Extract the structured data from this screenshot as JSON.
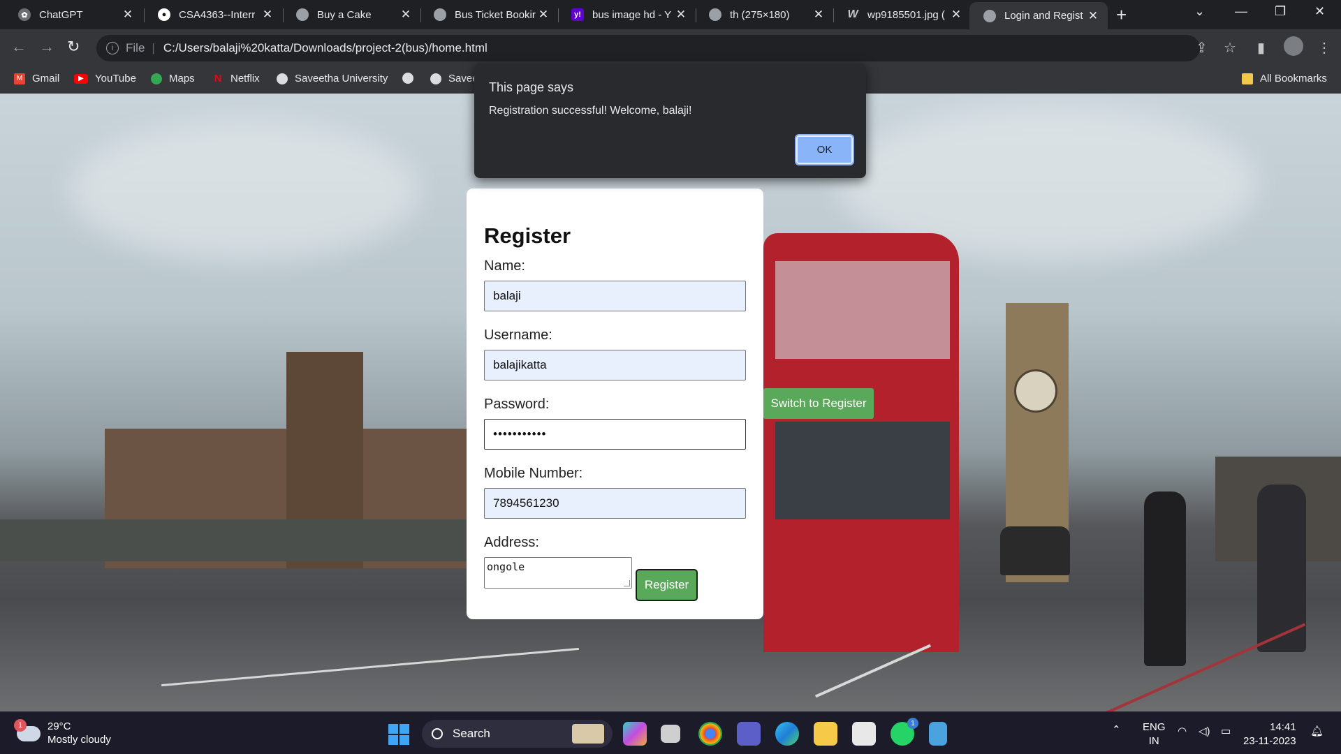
{
  "tabs": [
    {
      "title": "ChatGPT",
      "favicon": "chatgpt-icon"
    },
    {
      "title": "CSA4363--Interr",
      "favicon": "github-icon"
    },
    {
      "title": "Buy a Cake",
      "favicon": "globe-icon"
    },
    {
      "title": "Bus Ticket Bookir",
      "favicon": "globe-icon"
    },
    {
      "title": "bus image hd - Y",
      "favicon": "yahoo-icon"
    },
    {
      "title": "th (275×180)",
      "favicon": "globe-icon"
    },
    {
      "title": "wp9185501.jpg (",
      "favicon": "w-icon"
    },
    {
      "title": "Login and Regist",
      "favicon": "globe-icon",
      "active": true
    }
  ],
  "address": {
    "scheme": "File",
    "url": "C:/Users/balaji%20katta/Downloads/project-2(bus)/home.html"
  },
  "bookmarks": [
    {
      "label": "Gmail",
      "icon": "gmail-icon"
    },
    {
      "label": "YouTube",
      "icon": "youtube-icon"
    },
    {
      "label": "Maps",
      "icon": "maps-icon"
    },
    {
      "label": "Netflix",
      "icon": "netflix-icon"
    },
    {
      "label": "Saveetha University",
      "icon": "globe-icon"
    },
    {
      "label": "",
      "icon": "globe-icon"
    },
    {
      "label": "Savee",
      "icon": "globe-icon"
    }
  ],
  "all_bookmarks": "All Bookmarks",
  "dialog": {
    "title": "This page says",
    "message": "Registration successful! Welcome, balaji!",
    "ok_label": "OK"
  },
  "form": {
    "heading": "Register",
    "name_label": "Name:",
    "name_value": "balaji",
    "username_label": "Username:",
    "username_value": "balajikatta",
    "password_label": "Password:",
    "password_value": "•••••••••••",
    "mobile_label": "Mobile Number:",
    "mobile_value": "7894561230",
    "address_label": "Address:",
    "address_value": "ongole",
    "register_label": "Register",
    "switch_label": "Switch to Register"
  },
  "taskbar": {
    "weather_badge": "1",
    "temperature": "29°C",
    "condition": "Mostly cloudy",
    "search_placeholder": "Search",
    "whatsapp_badge": "1",
    "language": "ENG",
    "region": "IN",
    "time": "14:41",
    "date": "23-11-2023"
  },
  "colors": {
    "accent_green": "#5aa85a",
    "dialog_bg": "#292a2d",
    "ok_button": "#8ab4f8"
  }
}
